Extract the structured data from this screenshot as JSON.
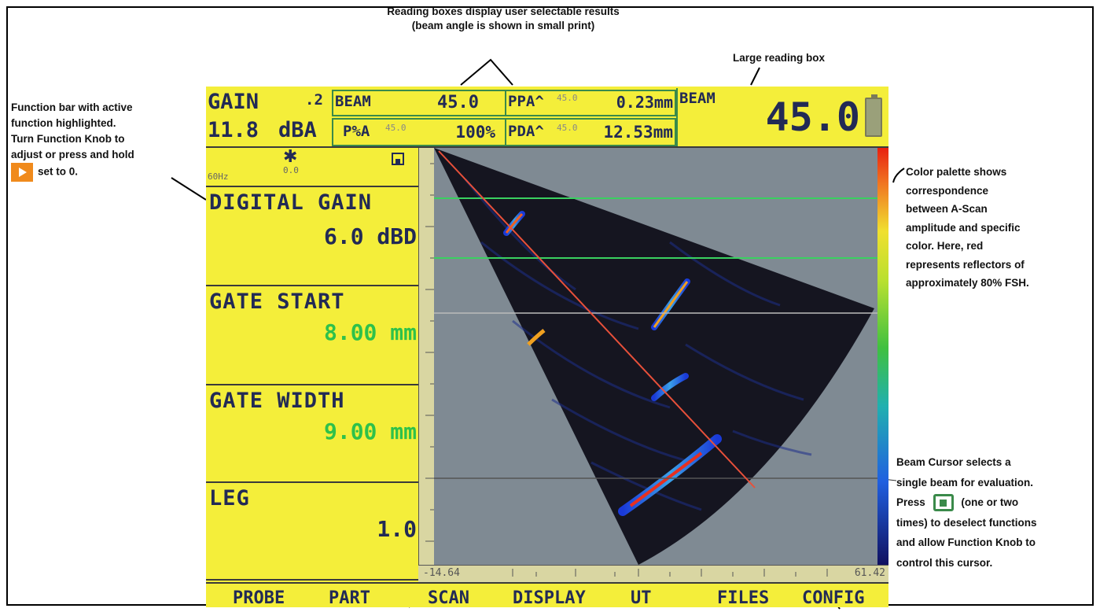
{
  "annotations": {
    "top_line1": "Reading boxes display user selectable results",
    "top_line2": "(beam angle is shown in small print)",
    "large_box": "Large reading box",
    "left": [
      "Function bar with active",
      "function highlighted.",
      "Turn Function Knob to",
      "adjust or press and hold",
      "set to 0."
    ],
    "right_top": [
      "Color palette shows",
      "correspondence",
      "between A-Scan",
      "amplitude and specific",
      "color. Here, red",
      "represents reflectors of",
      "approximately 80% FSH."
    ],
    "right_bottom": [
      "Beam Cursor selects a",
      "single beam for evaluation.",
      "Press",
      "(one or two",
      "times) to deselect functions",
      "and allow Function Knob to",
      "control this cursor."
    ]
  },
  "header": {
    "gain_label": "GAIN",
    "gain_step": ".2",
    "gain_value": "11.8",
    "gain_unit": "dBA",
    "beam_label": "BEAM",
    "beam_value": "45.0",
    "ppa_label": "PPA^",
    "ppa_angle": "45.0",
    "ppa_value": "0.23mm",
    "pxa_label": "P%A",
    "pxa_angle": "45.0",
    "pxa_value": "100%",
    "pda_label": "PDA^",
    "pda_angle": "45.0",
    "pda_value": "12.53mm",
    "large_label": "BEAM",
    "large_value": "45.0"
  },
  "status": {
    "freq": "60Hz",
    "sun_value": "0.0"
  },
  "panels": [
    {
      "title": "DIGITAL GAIN",
      "value": "6.0 dBD"
    },
    {
      "title": "GATE START",
      "value": "8.00 mm"
    },
    {
      "title": "GATE WIDTH",
      "value": "9.00 mm"
    },
    {
      "title": "LEG",
      "value": "1.0"
    }
  ],
  "scale": {
    "left": "-14.64",
    "right": "61.42"
  },
  "function_bar": [
    "PROBE",
    "PART",
    "SCAN",
    "DISPLAY",
    "UT",
    "FILES",
    "CONFIG"
  ],
  "colors": {
    "screen": "#f4ee3a",
    "border": "#3a8a4a",
    "value_green": "#2ec14a",
    "scan_bg": "#7f8a93"
  }
}
